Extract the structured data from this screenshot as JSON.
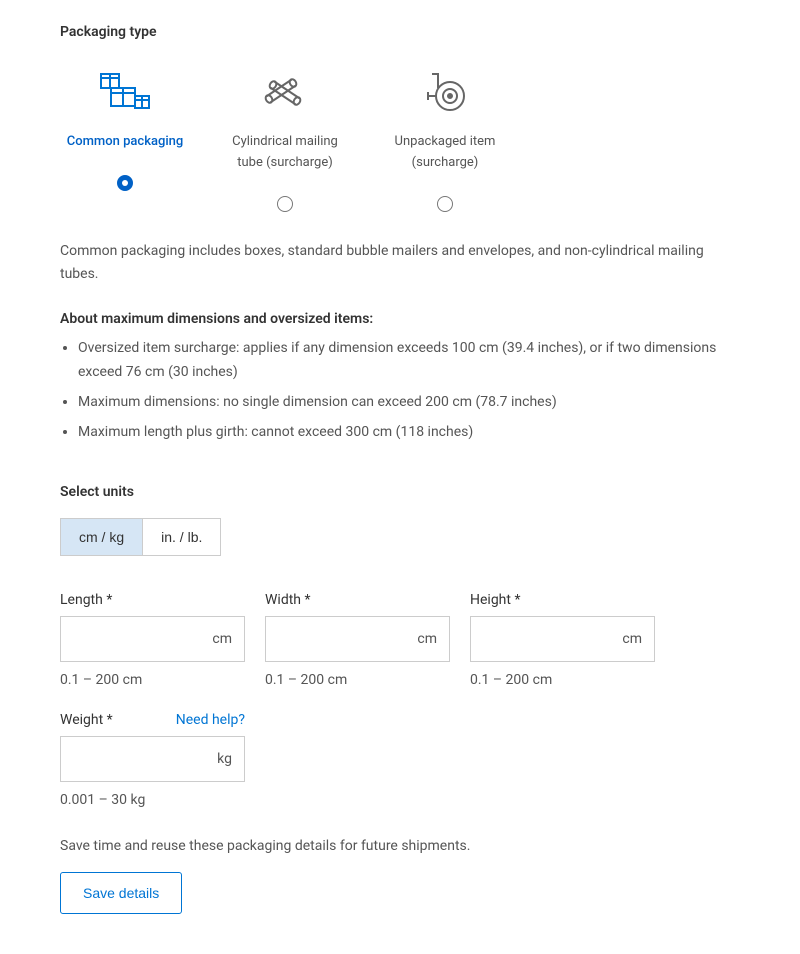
{
  "section_title": "Packaging type",
  "options": [
    {
      "label": "Common packaging",
      "selected": true
    },
    {
      "label": "Cylindrical mailing tube (surcharge)",
      "selected": false
    },
    {
      "label": "Unpackaged item (surcharge)",
      "selected": false
    }
  ],
  "description": "Common packaging includes boxes, standard bubble mailers and envelopes, and non-cylindrical mailing tubes.",
  "dimensions_heading": "About maximum dimensions and oversized items:",
  "dimensions_bullets": [
    "Oversized item surcharge: applies if any dimension exceeds 100 cm (39.4 inches), or if two dimensions exceed 76 cm (30 inches)",
    "Maximum dimensions: no single dimension can exceed 200 cm (78.7 inches)",
    "Maximum length plus girth: cannot exceed 300 cm (118 inches)"
  ],
  "units": {
    "label": "Select units",
    "options": [
      "cm / kg",
      "in. / lb."
    ],
    "selected_index": 0
  },
  "fields": {
    "length": {
      "label": "Length *",
      "unit": "cm",
      "hint": "0.1 – 200 cm"
    },
    "width": {
      "label": "Width *",
      "unit": "cm",
      "hint": "0.1 – 200 cm"
    },
    "height": {
      "label": "Height *",
      "unit": "cm",
      "hint": "0.1 – 200 cm"
    },
    "weight": {
      "label": "Weight *",
      "unit": "kg",
      "hint": "0.001 – 30 kg",
      "help_label": "Need help?"
    }
  },
  "save": {
    "note": "Save time and reuse these packaging details for future shipments.",
    "button_label": "Save details"
  }
}
